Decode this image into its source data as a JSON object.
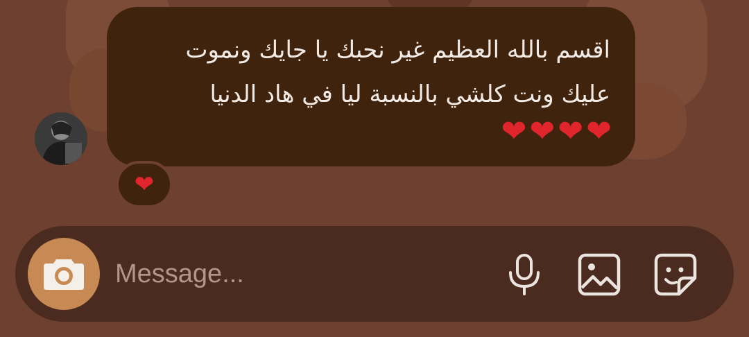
{
  "message": {
    "line1": "اقسم بالله العظيم غير نحبك يا جايك ونموت",
    "line2": "عليك ونت كلشي بالنسبة ليا في هاد الدنيا",
    "hearts": [
      "❤",
      "❤",
      "❤",
      "❤"
    ]
  },
  "reaction": {
    "emoji": "❤"
  },
  "composer": {
    "placeholder": "Message..."
  },
  "icons": {
    "avatar": "avatar-photo",
    "camera": "camera-icon",
    "mic": "microphone-icon",
    "gallery": "image-icon",
    "sticker": "sticker-icon"
  },
  "colors": {
    "background": "#6e4030",
    "bubble": "#40230d",
    "composer": "#4b2b1f",
    "camera_button": "#c78a55",
    "heart": "#e0252c"
  }
}
